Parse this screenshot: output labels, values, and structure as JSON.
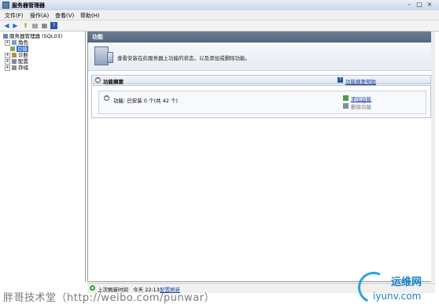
{
  "window": {
    "title": "服务器管理器"
  },
  "menu": [
    "文件(F)",
    "操作(A)",
    "查看(V)",
    "帮助(H)"
  ],
  "tree": {
    "root": "服务器管理器 (SQL03)",
    "items": [
      {
        "label": "角色",
        "selected": false
      },
      {
        "label": "功能",
        "selected": true
      },
      {
        "label": "诊断",
        "selected": false
      },
      {
        "label": "配置",
        "selected": false
      },
      {
        "label": "存储",
        "selected": false
      }
    ]
  },
  "content": {
    "header": "功能",
    "intro": "查看安装在此服务器上功能的状态，以及添加或删除功能。",
    "summary": {
      "title": "功能摘要",
      "help_link": "功能摘要帮助",
      "installed_text": "功能: 已安装 0 个(共 42 个)",
      "add_link": "添加功能",
      "remove_link": "删除功能"
    }
  },
  "status": {
    "label": "上次刷新时间",
    "time": "今天 22:13",
    "refresh_link": "配置刷新"
  },
  "watermark": "胖哥技术堂（http://weibo.com/punwar）",
  "logo": {
    "top": "运维网",
    "bottom": "iyunv.com"
  }
}
